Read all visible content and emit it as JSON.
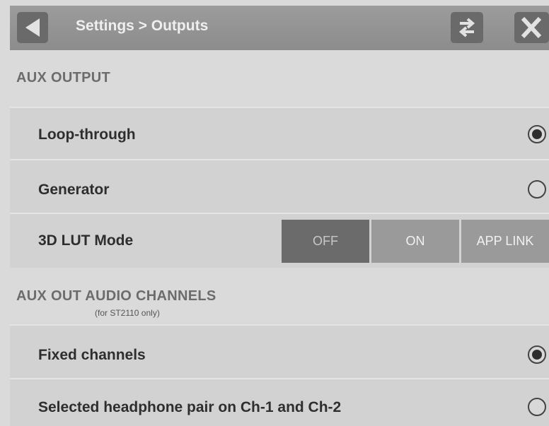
{
  "header": {
    "title": "Settings > Outputs",
    "icons": {
      "back": "back-arrow-icon",
      "swap": "swap-arrows-icon",
      "close": "close-x-icon"
    }
  },
  "aux_output": {
    "title": "AUX OUTPUT",
    "options": [
      {
        "label": "Loop-through",
        "selected": true
      },
      {
        "label": "Generator",
        "selected": false
      }
    ],
    "lut": {
      "label": "3D LUT Mode",
      "buttons": [
        "OFF",
        "ON",
        "APP LINK"
      ],
      "selected": "OFF"
    }
  },
  "aux_audio": {
    "title": "AUX OUT AUDIO CHANNELS",
    "subtitle": "(for ST2110 only)",
    "options": [
      {
        "label": "Fixed channels",
        "selected": true
      },
      {
        "label": "Selected headphone pair on Ch-1 and Ch-2",
        "selected": false
      }
    ]
  },
  "colors": {
    "header_bg": "#959595",
    "selected_segment": "#6b6b6b",
    "unselected_segment": "#9a9a9a"
  }
}
